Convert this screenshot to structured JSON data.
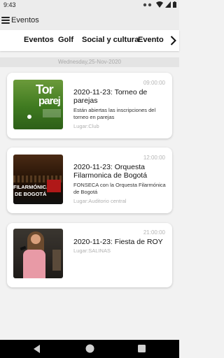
{
  "status": {
    "time": "9:43"
  },
  "appbar": {
    "title": "Eventos"
  },
  "tabs": [
    {
      "label": "Eventos"
    },
    {
      "label": "Golf"
    },
    {
      "label": "Social y cultura"
    },
    {
      "label": "Evento"
    }
  ],
  "date_header": "Wednesday,25-Nov-2020",
  "events": [
    {
      "time": "09:00:00",
      "title": "2020-11-23: Torneo de parejas",
      "description": "Están abiertas las inscripciones del torneo en parejas",
      "place": "Lugar:Club",
      "thumb_text_1": "Tor",
      "thumb_text_2": "parej"
    },
    {
      "time": "12:00:00",
      "title": "2020-11-23: Orquesta Filarmonica de Bogotá",
      "description": "FONSECA con la Orquesta Filarmónica de Bogotá",
      "place": "Lugar:Auditorio central",
      "thumb_text_1": "FILARMÓNICA",
      "thumb_text_2": "DE BOGOTÁ"
    },
    {
      "time": "21:00:00",
      "title": "2020-11-23: Fiesta de ROY",
      "description": "",
      "place": "Lugar:SALINAS"
    }
  ],
  "colors": {
    "background": "#f2f2f2",
    "card": "#ffffff",
    "navbar": "#000000"
  }
}
